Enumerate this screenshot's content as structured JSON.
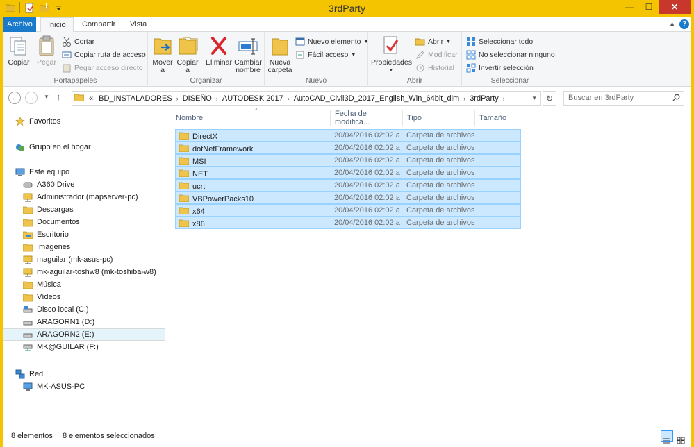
{
  "window": {
    "title": "3rdParty"
  },
  "tabs": {
    "file": "Archivo",
    "home": "Inicio",
    "share": "Compartir",
    "view": "Vista"
  },
  "ribbon": {
    "portapapeles": {
      "label": "Portapapeles",
      "copy": "Copiar",
      "paste": "Pegar",
      "cut": "Cortar",
      "copy_path": "Copiar ruta de acceso",
      "paste_shortcut": "Pegar acceso directo"
    },
    "organizar": {
      "label": "Organizar",
      "move_1": "Mover",
      "move_2": "a",
      "copy_1": "Copiar",
      "copy_2": "a",
      "delete": "Eliminar",
      "rename_1": "Cambiar",
      "rename_2": "nombre"
    },
    "nuevo": {
      "label": "Nuevo",
      "new_folder_1": "Nueva",
      "new_folder_2": "carpeta",
      "new_item": "Nuevo elemento",
      "easy_access": "Fácil acceso"
    },
    "abrir": {
      "label": "Abrir",
      "properties": "Propiedades",
      "open": "Abrir",
      "modify": "Modificar",
      "history": "Historial"
    },
    "seleccionar": {
      "label": "Seleccionar",
      "select_all": "Seleccionar todo",
      "select_none": "No seleccionar ninguno",
      "invert": "Invertir selección"
    }
  },
  "address": {
    "overflow": "«",
    "crumbs": [
      "BD_INSTALADORES",
      "DISEÑO",
      "AUTODESK 2017",
      "AutoCAD_Civil3D_2017_English_Win_64bit_dlm",
      "3rdParty"
    ],
    "search_placeholder": "Buscar en 3rdParty"
  },
  "nav": {
    "favorites": "Favoritos",
    "homegroup": "Grupo en el hogar",
    "this_pc": "Este equipo",
    "pc_items": [
      "A360 Drive",
      "Administrador (mapserver-pc)",
      "Descargas",
      "Documentos",
      "Escritorio",
      "Imágenes",
      "maguilar (mk-asus-pc)",
      "mk-aguilar-toshw8 (mk-toshiba-w8)",
      "Música",
      "Vídeos",
      "Disco local (C:)",
      "ARAGORN1 (D:)",
      "ARAGORN2 (E:)",
      "MK@GUILAR (F:)"
    ],
    "network": "Red",
    "network_items": [
      "MK-ASUS-PC"
    ]
  },
  "columns": {
    "name": "Nombre",
    "date": "Fecha de modifica...",
    "type": "Tipo",
    "size": "Tamaño"
  },
  "files": [
    {
      "name": "DirectX",
      "date": "20/04/2016 02:02 a...",
      "type": "Carpeta de archivos"
    },
    {
      "name": "dotNetFramework",
      "date": "20/04/2016 02:02 a...",
      "type": "Carpeta de archivos"
    },
    {
      "name": "MSI",
      "date": "20/04/2016 02:02 a...",
      "type": "Carpeta de archivos"
    },
    {
      "name": "NET",
      "date": "20/04/2016 02:02 a...",
      "type": "Carpeta de archivos"
    },
    {
      "name": "ucrt",
      "date": "20/04/2016 02:02 a...",
      "type": "Carpeta de archivos"
    },
    {
      "name": "VBPowerPacks10",
      "date": "20/04/2016 02:02 a...",
      "type": "Carpeta de archivos"
    },
    {
      "name": "x64",
      "date": "20/04/2016 02:02 a...",
      "type": "Carpeta de archivos"
    },
    {
      "name": "x86",
      "date": "20/04/2016 02:02 a...",
      "type": "Carpeta de archivos"
    }
  ],
  "status": {
    "count": "8 elementos",
    "selected": "8 elementos seleccionados"
  },
  "colors": {
    "title_bar": "#f5c400",
    "file_tab": "#1979ca",
    "selection": "#cce8ff",
    "close": "#c7372c"
  }
}
